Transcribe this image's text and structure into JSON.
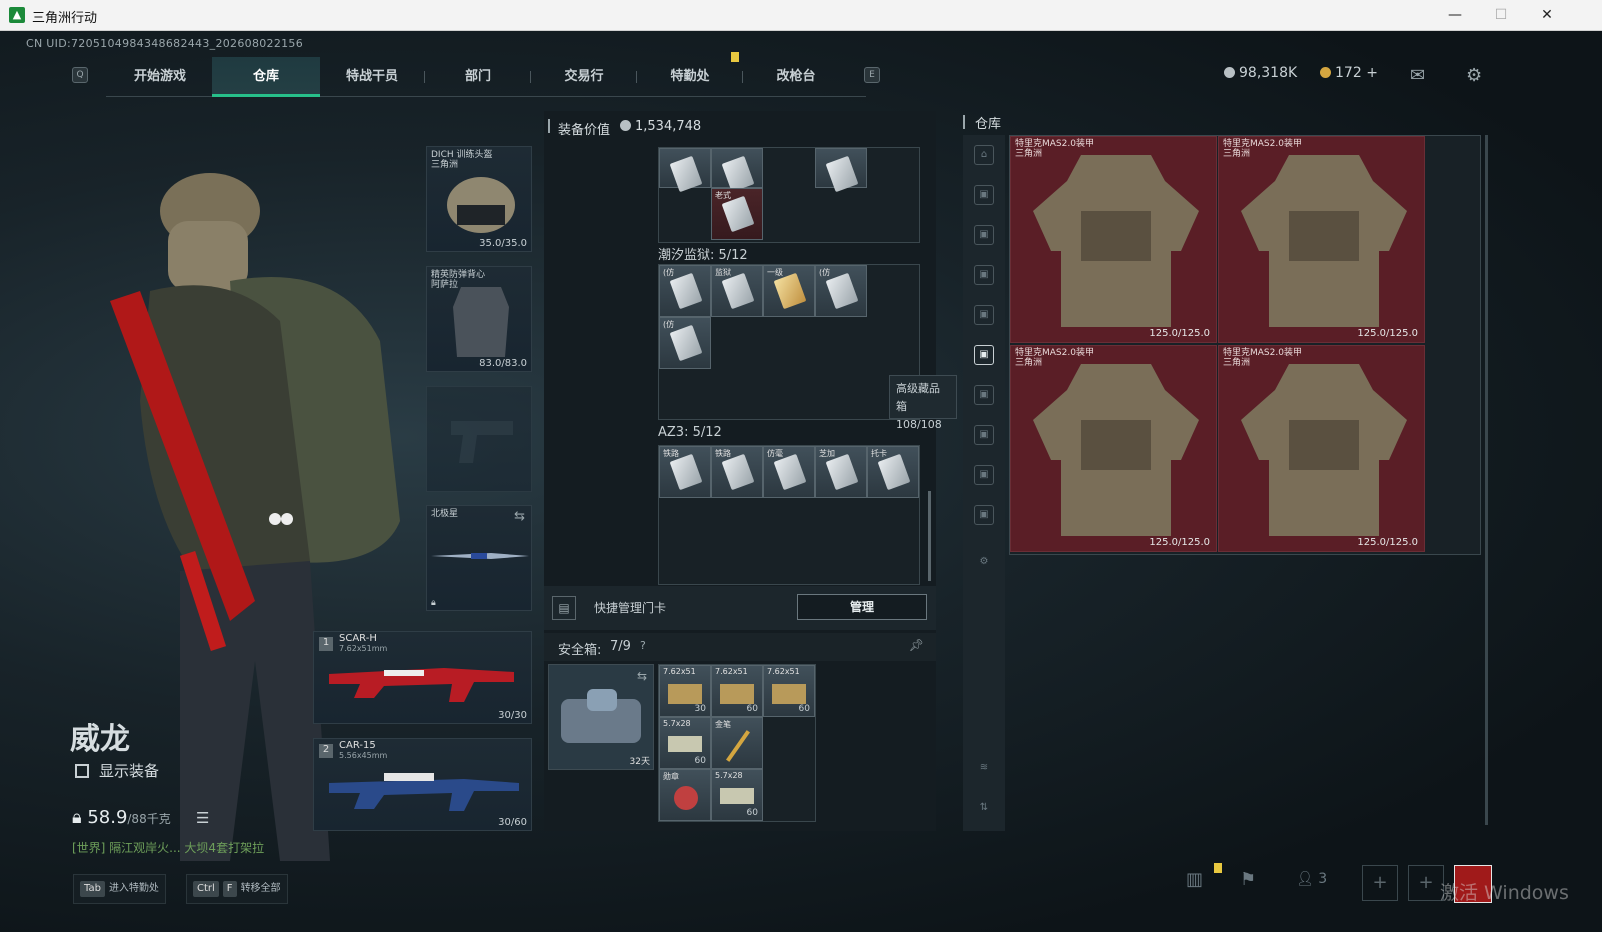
{
  "window": {
    "title": "三角洲行动",
    "min": "—",
    "max": "☐",
    "close": "✕"
  },
  "uid": "CN UID:7205104984348682443_202608022156",
  "tabs": [
    "开始游戏",
    "仓库",
    "特战干员",
    "部门",
    "交易行",
    "特勤处",
    "改枪台"
  ],
  "tab_keys": {
    "left": "Q",
    "right": "E"
  },
  "currency": {
    "silver": "98,318K",
    "gold": "172",
    "plus": "+"
  },
  "operator": {
    "name": "威龙",
    "show_equipment": "显示装备",
    "weight": "58.9",
    "weight_max": "/88千克"
  },
  "chat": "[世界] 隔江观岸火... 大坝4套打架拉",
  "bottom": {
    "tab_key": "Tab",
    "tab_label": "进入特勤处",
    "ctrl_key": "Ctrl",
    "f_key": "F",
    "transfer_label": "转移全部"
  },
  "equipment": {
    "helmet": {
      "label1": "DICH 训练头盔",
      "label2": "三角洲",
      "value": "35.0/35.0"
    },
    "armor": {
      "label1": "精英防弹背心",
      "label2": "阿萨拉",
      "value": "83.0/83.0"
    },
    "melee": {
      "label": "北极星"
    },
    "primary": {
      "slot": "1",
      "name": "SCAR-H",
      "caliber": "7.62x51mm",
      "ammo": "30/30"
    },
    "secondary": {
      "slot": "2",
      "name": "CAR-15",
      "caliber": "5.56x45mm",
      "ammo": "30/60"
    }
  },
  "middle": {
    "equip_value_label": "装备价值",
    "equip_value": "1,534,748",
    "top_item_label": "老式",
    "section1": "潮汐监狱: 5/12",
    "section1_items": [
      "(仿",
      "监狱",
      "一级",
      "(仿",
      "(仿"
    ],
    "section2": "AZ3: 5/12",
    "section2_items": [
      "铁路",
      "铁路",
      "仿毫",
      "芝加",
      "托卡"
    ],
    "quick_card": "快捷管理门卡",
    "manage": "管理",
    "safebox_label": "安全箱:",
    "safebox_count": "7/9",
    "safebox_days": "32天",
    "safebox_items": [
      {
        "label": "7.62x51",
        "count": "30"
      },
      {
        "label": "7.62x51",
        "count": "60"
      },
      {
        "label": "7.62x51",
        "count": "60"
      },
      {
        "label": "5.7x28",
        "count": "60"
      },
      {
        "label": "金笔",
        "count": ""
      },
      {
        "label": "勋章",
        "count": ""
      },
      {
        "label": "5.7x28",
        "count": "60"
      }
    ]
  },
  "tooltip": {
    "title": "高级藏品箱",
    "value": "108/108"
  },
  "warehouse": {
    "title": "仓库",
    "items": [
      {
        "label1": "特里克MAS2.0装甲",
        "label2": "三角洲",
        "value": "125.0/125.0"
      },
      {
        "label1": "特里克MAS2.0装甲",
        "label2": "三角洲",
        "value": "125.0/125.0"
      },
      {
        "label1": "特里克MAS2.0装甲",
        "label2": "三角洲",
        "value": "125.0/125.0"
      },
      {
        "label1": "特里克MAS2.0装甲",
        "label2": "三角洲",
        "value": "125.0/125.0"
      }
    ]
  },
  "taskbar": {
    "friends": "3",
    "watermark": "激活 Windows"
  },
  "colors": {
    "accent": "#27c08a",
    "warehouse_item": "#5a1e26",
    "chat": "#6ea05a"
  }
}
